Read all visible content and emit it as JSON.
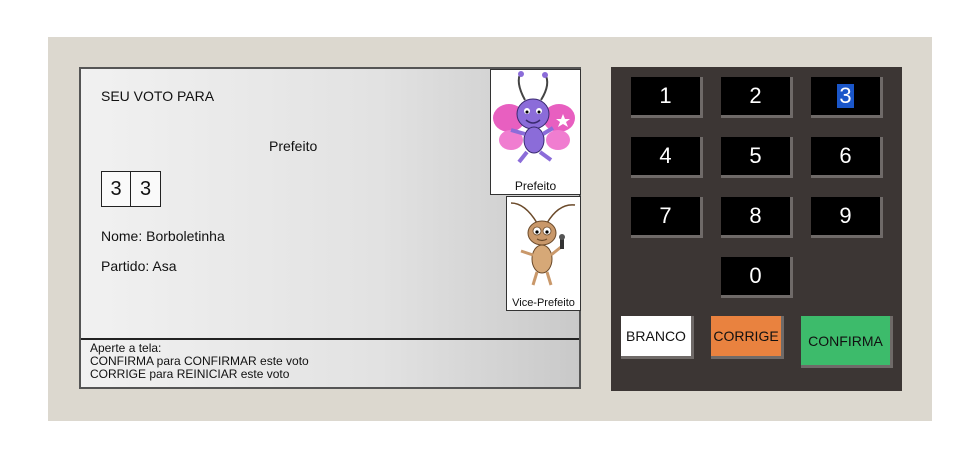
{
  "screen": {
    "title": "SEU VOTO PARA",
    "office": "Prefeito",
    "digits": [
      "3",
      "3"
    ],
    "name_line": "Nome: Borboletinha",
    "party_line": "Partido: Asa",
    "photos": {
      "main_caption": "Prefeito",
      "vice_caption": "Vice-Prefeito"
    },
    "instructions": {
      "line1": "Aperte a tela:",
      "line2": "CONFIRMA para CONFIRMAR este voto",
      "line3": "CORRIGE para REINICIAR este voto"
    }
  },
  "keypad": {
    "keys": [
      "1",
      "2",
      "3",
      "4",
      "5",
      "6",
      "7",
      "8",
      "9",
      "0"
    ],
    "highlighted_key": "3",
    "branco_label": "BRANCO",
    "corrige_label": "CORRIGE",
    "confirma_label": "CONFIRMA"
  },
  "colors": {
    "keypad_bg": "#3c3634",
    "branco": "#ffffff",
    "corrige": "#e9823f",
    "confirma": "#3dbb6b",
    "selection": "#1a56c9"
  }
}
